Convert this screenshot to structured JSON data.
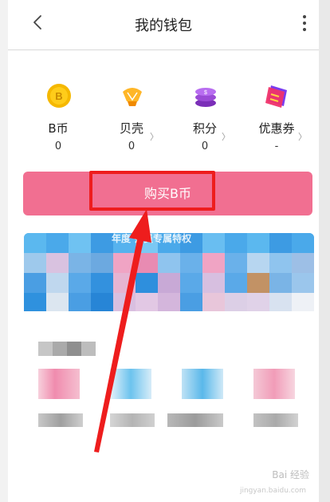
{
  "header": {
    "title": "我的钱包",
    "back_icon": "chevron-left-icon",
    "more_icon": "more-vertical-icon"
  },
  "assets": [
    {
      "name": "B币",
      "value": "0",
      "icon": "bcoin-icon",
      "color": "#f5b800",
      "chevron": false
    },
    {
      "name": "贝壳",
      "value": "0",
      "icon": "shell-icon",
      "color": "#f7a21b",
      "chevron": true
    },
    {
      "name": "积分",
      "value": "0",
      "icon": "points-icon",
      "color": "#9b4bd6",
      "chevron": true
    },
    {
      "name": "优惠券",
      "value": "-",
      "icon": "coupon-icon",
      "color": "#e8346a",
      "chevron": true
    }
  ],
  "buy_button": {
    "label": "购买B币",
    "color": "#f16f91"
  },
  "banner": {
    "text": "年度 会员专属特权"
  },
  "watermark": {
    "line1": "Bai 经验",
    "line2": "jingyan.baidu.com"
  },
  "colors": {
    "annotation_red": "#ee1d1d",
    "accent_pink": "#f16f91"
  }
}
